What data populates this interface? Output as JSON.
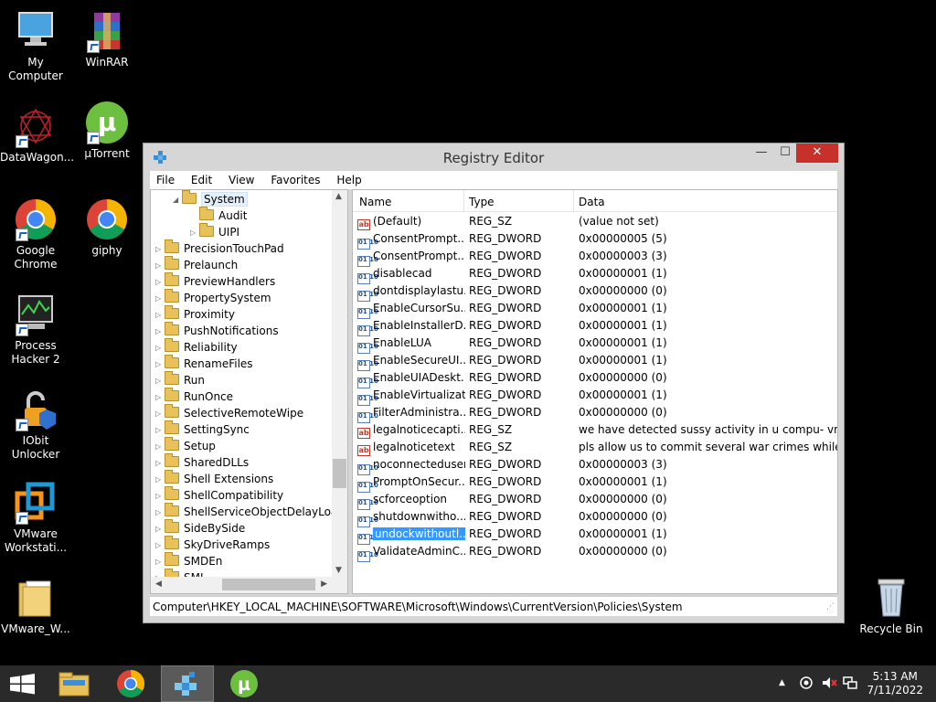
{
  "desktop": {
    "icons": [
      {
        "label": "My Computer"
      },
      {
        "label": "WinRAR"
      },
      {
        "label": "DataWagon..."
      },
      {
        "label": "µTorrent"
      },
      {
        "label": "Google Chrome"
      },
      {
        "label": "giphy"
      },
      {
        "label": "Process Hacker 2"
      },
      {
        "label": "IObit Unlocker"
      },
      {
        "label": "VMware Workstati..."
      },
      {
        "label": "VMware_W..."
      },
      {
        "label": "Recycle Bin"
      }
    ]
  },
  "window": {
    "title": "Registry Editor",
    "controls": {
      "minimize": "—",
      "maximize": "☐",
      "close": "✕"
    },
    "menu": [
      "File",
      "Edit",
      "View",
      "Favorites",
      "Help"
    ],
    "tree": {
      "selected": "System",
      "children": [
        "Audit",
        "UIPI"
      ],
      "siblings": [
        "PrecisionTouchPad",
        "Prelaunch",
        "PreviewHandlers",
        "PropertySystem",
        "Proximity",
        "PushNotifications",
        "Reliability",
        "RenameFiles",
        "Run",
        "RunOnce",
        "SelectiveRemoteWipe",
        "SettingSync",
        "Setup",
        "SharedDLLs",
        "Shell Extensions",
        "ShellCompatibility",
        "ShellServiceObjectDelayLoad",
        "SideBySide",
        "SkyDriveRamps",
        "SMDEn",
        "SMI"
      ]
    },
    "list": {
      "columns": [
        "Name",
        "Type",
        "Data"
      ],
      "rows": [
        {
          "icon": "string",
          "name": "(Default)",
          "type": "REG_SZ",
          "data": "(value not set)"
        },
        {
          "icon": "dword",
          "name": "ConsentPrompt...",
          "type": "REG_DWORD",
          "data": "0x00000005 (5)"
        },
        {
          "icon": "dword",
          "name": "ConsentPrompt...",
          "type": "REG_DWORD",
          "data": "0x00000003 (3)"
        },
        {
          "icon": "dword",
          "name": "disablecad",
          "type": "REG_DWORD",
          "data": "0x00000001 (1)"
        },
        {
          "icon": "dword",
          "name": "dontdisplaylastu...",
          "type": "REG_DWORD",
          "data": "0x00000000 (0)"
        },
        {
          "icon": "dword",
          "name": "EnableCursorSu...",
          "type": "REG_DWORD",
          "data": "0x00000001 (1)"
        },
        {
          "icon": "dword",
          "name": "EnableInstallerD...",
          "type": "REG_DWORD",
          "data": "0x00000001 (1)"
        },
        {
          "icon": "dword",
          "name": "EnableLUA",
          "type": "REG_DWORD",
          "data": "0x00000001 (1)"
        },
        {
          "icon": "dword",
          "name": "EnableSecureUI...",
          "type": "REG_DWORD",
          "data": "0x00000001 (1)"
        },
        {
          "icon": "dword",
          "name": "EnableUIADeskt...",
          "type": "REG_DWORD",
          "data": "0x00000000 (0)"
        },
        {
          "icon": "dword",
          "name": "EnableVirtualizat...",
          "type": "REG_DWORD",
          "data": "0x00000001 (1)"
        },
        {
          "icon": "dword",
          "name": "FilterAdministra...",
          "type": "REG_DWORD",
          "data": "0x00000000 (0)"
        },
        {
          "icon": "string",
          "name": "legalnoticecapti...",
          "type": "REG_SZ",
          "data": "we have detected sussy activity in u compu- vm"
        },
        {
          "icon": "string",
          "name": "legalnoticetext",
          "type": "REG_SZ",
          "data": "pls allow us to commit several war crimes while w..."
        },
        {
          "icon": "dword",
          "name": "noconnecteduser",
          "type": "REG_DWORD",
          "data": "0x00000003 (3)"
        },
        {
          "icon": "dword",
          "name": "PromptOnSecur...",
          "type": "REG_DWORD",
          "data": "0x00000001 (1)"
        },
        {
          "icon": "dword",
          "name": "scforceoption",
          "type": "REG_DWORD",
          "data": "0x00000000 (0)"
        },
        {
          "icon": "dword",
          "name": "shutdownwitho...",
          "type": "REG_DWORD",
          "data": "0x00000000 (0)"
        },
        {
          "icon": "dword",
          "name": "undockwithoutl...",
          "type": "REG_DWORD",
          "data": "0x00000001 (1)",
          "selected": true
        },
        {
          "icon": "dword",
          "name": "ValidateAdminC...",
          "type": "REG_DWORD",
          "data": "0x00000000 (0)"
        }
      ]
    },
    "status": "Computer\\HKEY_LOCAL_MACHINE\\SOFTWARE\\Microsoft\\Windows\\CurrentVersion\\Policies\\System"
  },
  "taskbar": {
    "time": "5:13 AM",
    "date": "7/11/2022"
  },
  "colors": {
    "accent": "#3399ff",
    "close": "#c7302b",
    "taskbar": "#2a2a2a"
  }
}
